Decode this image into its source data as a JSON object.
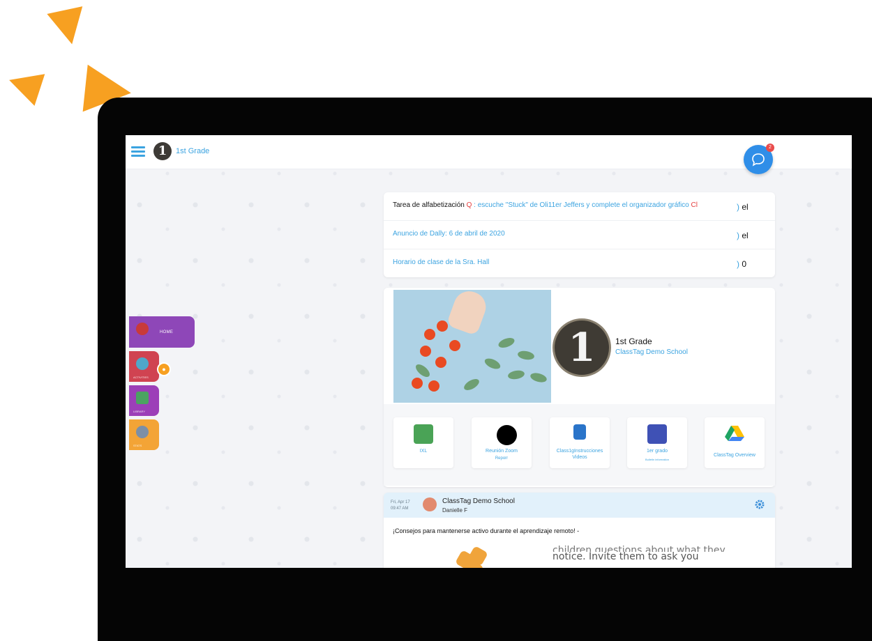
{
  "topbar": {
    "class_badge": "1",
    "class_name": "1st Grade",
    "chat_badge_count": "2"
  },
  "nav": {
    "home": "HOME",
    "activities": "ACTIVITIES",
    "library": "LIBRARY",
    "stats": "STATS"
  },
  "announcements": [
    {
      "parts": [
        {
          "text": "Tarea de alfabetización ",
          "color": "dark"
        },
        {
          "text": "Q",
          "color": "red"
        },
        {
          "text": " : escuche \"Stuck\" de Oli11er Jeffers y complete el organizador gráfico ",
          "color": "blue"
        },
        {
          "text": "Cl",
          "color": "red"
        }
      ],
      "count_prefix": ")",
      "count": " el"
    },
    {
      "parts": [
        {
          "text": "Anuncio de Dally: 6 de abril de 2020",
          "color": "blue"
        }
      ],
      "count_prefix": ")",
      "count": " el"
    },
    {
      "parts": [
        {
          "text": "Horario de clase de la Sra. Hall",
          "color": "blue"
        }
      ],
      "count_prefix": ")",
      "count": " 0"
    }
  ],
  "class_card": {
    "badge": "1",
    "title": "1st Grade",
    "school": "ClassTag Demo School"
  },
  "tiles": [
    {
      "label": "IXL",
      "sub": "",
      "icon_color": "#4aa356"
    },
    {
      "label": "Reunión Zoom",
      "sub": "Reporr",
      "icon_color": "#ffffff"
    },
    {
      "label": "Class1gInstrucciones Videos",
      "sub": "",
      "icon_color": "#2a74c9"
    },
    {
      "label": "1er grado",
      "sub": "Bulletin information",
      "icon_color": "#3f51b5"
    },
    {
      "label": "ClassTag Overview",
      "sub": "",
      "icon_color": "#1fa463"
    }
  ],
  "post": {
    "date": "Fri, Apr 17",
    "time": "09:47 AM",
    "school": "ClassTag Demo School",
    "author": "Danielle F",
    "body": "¡Consejos para mantenerse activo durante el aprendizaje remoto! -",
    "image_text_1": "children questions about what they",
    "image_text_2": "notice. Invite them to ask you"
  },
  "colors": {
    "accent_blue": "#3ba3e0",
    "brand_orange": "#f7a021",
    "home_purple": "#8e47b8",
    "activities_red": "#d04351",
    "library_purple": "#9c3fb8",
    "stats_orange": "#f3a436"
  }
}
